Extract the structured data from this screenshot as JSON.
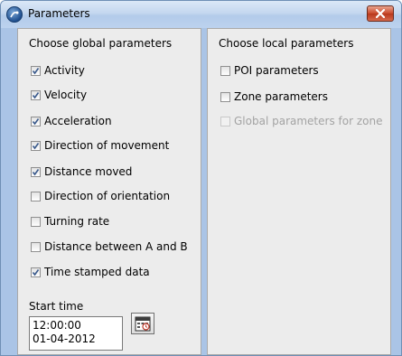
{
  "window": {
    "title": "Parameters"
  },
  "global": {
    "heading": "Choose global parameters",
    "items": [
      {
        "label": "Activity",
        "checked": true
      },
      {
        "label": "Velocity",
        "checked": true
      },
      {
        "label": "Acceleration",
        "checked": true
      },
      {
        "label": "Direction of movement",
        "checked": true
      },
      {
        "label": "Distance moved",
        "checked": true
      },
      {
        "label": "Direction of orientation",
        "checked": false
      },
      {
        "label": "Turning rate",
        "checked": false
      },
      {
        "label": "Distance between A and B",
        "checked": false
      },
      {
        "label": "Time stamped data",
        "checked": true
      }
    ],
    "start_time": {
      "label": "Start time",
      "time": "12:00:00",
      "date": "01-04-2012"
    }
  },
  "local": {
    "heading": "Choose local parameters",
    "items": [
      {
        "label": "POI parameters",
        "checked": false,
        "enabled": true
      },
      {
        "label": "Zone parameters",
        "checked": false,
        "enabled": true
      },
      {
        "label": "Global parameters for zone",
        "checked": false,
        "enabled": false
      }
    ]
  },
  "icons": {
    "app": "app-logo-icon",
    "close": "close-icon",
    "calendar": "calendar-icon",
    "check": "checkmark-icon"
  },
  "colors": {
    "close_button": "#c9482b",
    "check_mark": "#3a5a8c",
    "disabled_text": "#a3a3a3"
  }
}
